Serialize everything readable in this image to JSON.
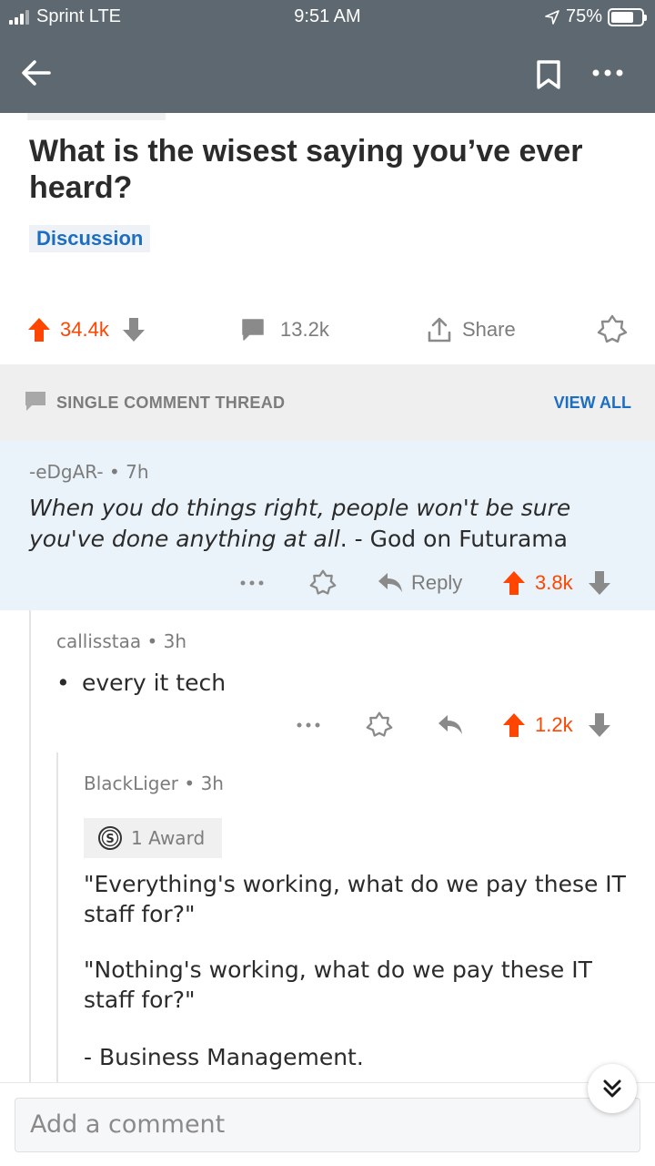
{
  "status_bar": {
    "carrier": "Sprint  LTE",
    "time": "9:51 AM",
    "battery": "75%",
    "battery_level": 0.75
  },
  "post": {
    "title": "What is the wisest saying you’ve ever heard?",
    "flair": "Discussion",
    "upvotes": "34.4k",
    "comments": "13.2k",
    "share_label": "Share"
  },
  "thread": {
    "label": "SINGLE COMMENT THREAD",
    "view_all": "VIEW ALL"
  },
  "comments": [
    {
      "author": "-eDgAR-",
      "age": "7h",
      "body_italic": "When you do things right, people won't be sure you've done anything at all",
      "body_rest": ". - God on Futurama",
      "reply_label": "Reply",
      "score": "3.8k"
    },
    {
      "author": "callisstaa",
      "age": "3h",
      "bullet": "•",
      "body": "every it tech",
      "score": "1.2k"
    },
    {
      "author": "BlackLiger",
      "age": "3h",
      "award": "1 Award",
      "paragraphs": [
        "\"Everything's working, what do we pay these IT staff for?\"",
        "\"Nothing's working, what do we pay these IT staff for?\"",
        "- Business Management."
      ]
    }
  ],
  "composer": {
    "placeholder": "Add a comment"
  },
  "colors": {
    "upvote": "#ff4500",
    "link": "#1c6ec2",
    "header": "#5e6870",
    "highlight": "#eaf3fa"
  }
}
